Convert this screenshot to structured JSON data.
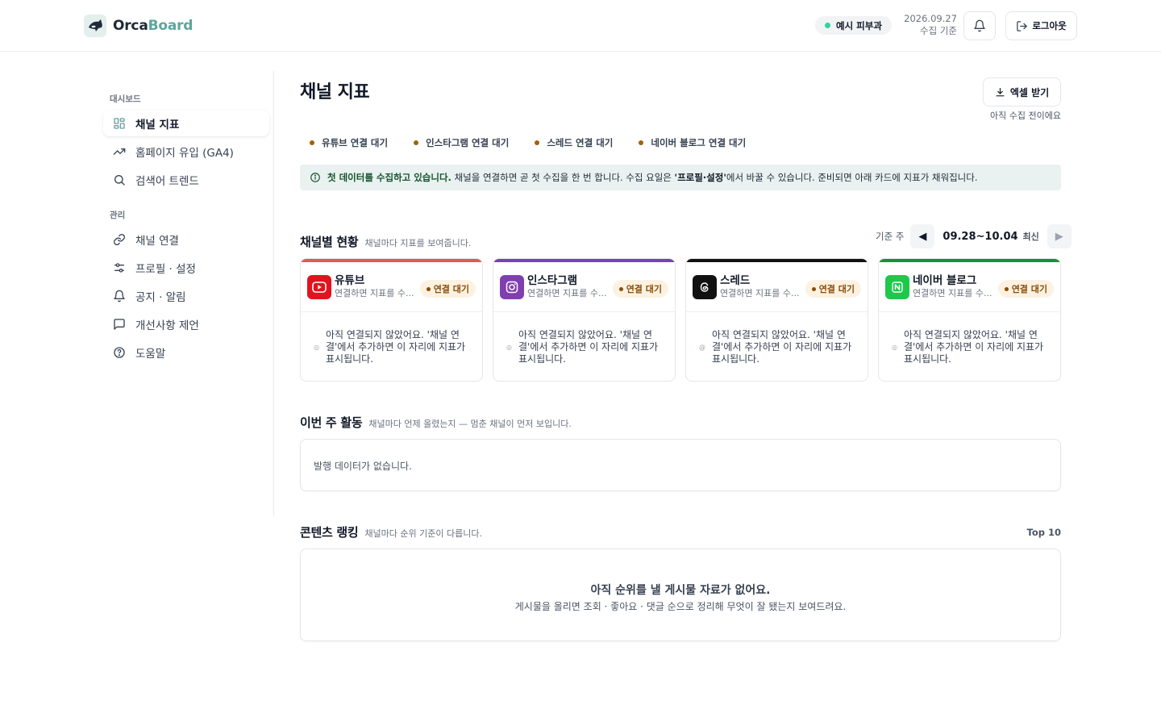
{
  "header": {
    "brand_a": "Orca",
    "brand_b": "Board",
    "org_name": "예시 피부과",
    "date": "2026.09.27",
    "date_note": "수집 기준",
    "logout_label": "로그아웃"
  },
  "sidebar": {
    "section_dashboard": "대시보드",
    "section_manage": "관리",
    "items": [
      {
        "label": "채널 지표",
        "icon": "grid-icon"
      },
      {
        "label": "홈페이지 유입 (GA4)",
        "icon": "trending-up-icon"
      },
      {
        "label": "검색어 트렌드",
        "icon": "search-icon"
      },
      {
        "label": "채널 연결",
        "icon": "link-icon"
      },
      {
        "label": "프로필 · 설정",
        "icon": "sliders-icon"
      },
      {
        "label": "공지 · 알림",
        "icon": "bell-icon"
      },
      {
        "label": "개선사항 제언",
        "icon": "message-icon"
      },
      {
        "label": "도움말",
        "icon": "help-icon"
      }
    ]
  },
  "main": {
    "title": "채널 지표",
    "excel_label": "엑셀 받기",
    "excel_note": "아직 수집 전이에요",
    "status": [
      {
        "label": "유튜브 연결 대기"
      },
      {
        "label": "인스타그램 연결 대기"
      },
      {
        "label": "스레드 연결 대기"
      },
      {
        "label": "네이버 블로그 연결 대기"
      }
    ],
    "notice": {
      "strong": "첫 데이터를 수집하고 있습니다.",
      "text_a": " 채널을 연결하면 곧 첫 수집을 한 번 합니다. 수집 요일은 ",
      "bold": "'프로필·설정'",
      "text_b": "에서 바꿀 수 있습니다. 준비되면 아래 카드에 지표가 채워집니다."
    },
    "channel_section": {
      "title": "채널별 현황",
      "subtitle": "채널마다 지표를 보여줍니다.",
      "week_label": "기준 주",
      "week_range": "09.28~10.04",
      "week_latest": "최신"
    },
    "channels": [
      {
        "name": "유튜브",
        "desc": "연결하면 지표를 수...",
        "badge": "연결 대기",
        "body": "아직 연결되지 않았어요. '채널 연결'에서 추가하면 이 자리에 지표가 표시됩니다.",
        "color": "#e05a4e",
        "icon_bg": "#e0141f"
      },
      {
        "name": "인스타그램",
        "desc": "연결하면 지표를 수...",
        "badge": "연결 대기",
        "body": "아직 연결되지 않았어요. '채널 연결'에서 추가하면 이 자리에 지표가 표시됩니다.",
        "color": "#7c3fb8",
        "icon_bg": "#7f3fb3"
      },
      {
        "name": "스레드",
        "desc": "연결하면 지표를 수...",
        "badge": "연결 대기",
        "body": "아직 연결되지 않았어요. '채널 연결'에서 추가하면 이 자리에 지표가 표시됩니다.",
        "color": "#111111",
        "icon_bg": "#111111"
      },
      {
        "name": "네이버 블로그",
        "desc": "연결하면 지표를 수...",
        "badge": "연결 대기",
        "body": "아직 연결되지 않았어요. '채널 연결'에서 추가하면 이 자리에 지표가 표시됩니다.",
        "color": "#1a8f32",
        "icon_bg": "#1ec84a"
      }
    ],
    "activity": {
      "title": "이번 주 활동",
      "subtitle": "채널마다 언제 올렸는지 — 멈춘 채널이 먼저 보입니다.",
      "empty": "발행 데이터가 없습니다."
    },
    "ranking": {
      "title": "콘텐츠 랭킹",
      "subtitle": "채널마다 순위 기준이 다릅니다.",
      "top_label": "Top 10",
      "empty_title": "아직 순위를 낼 게시물 자료가 없어요.",
      "empty_sub": "게시물을 올리면 조회 · 좋아요 · 댓글 순으로 정리해 무엇이 잘 됐는지 보여드려요."
    }
  }
}
